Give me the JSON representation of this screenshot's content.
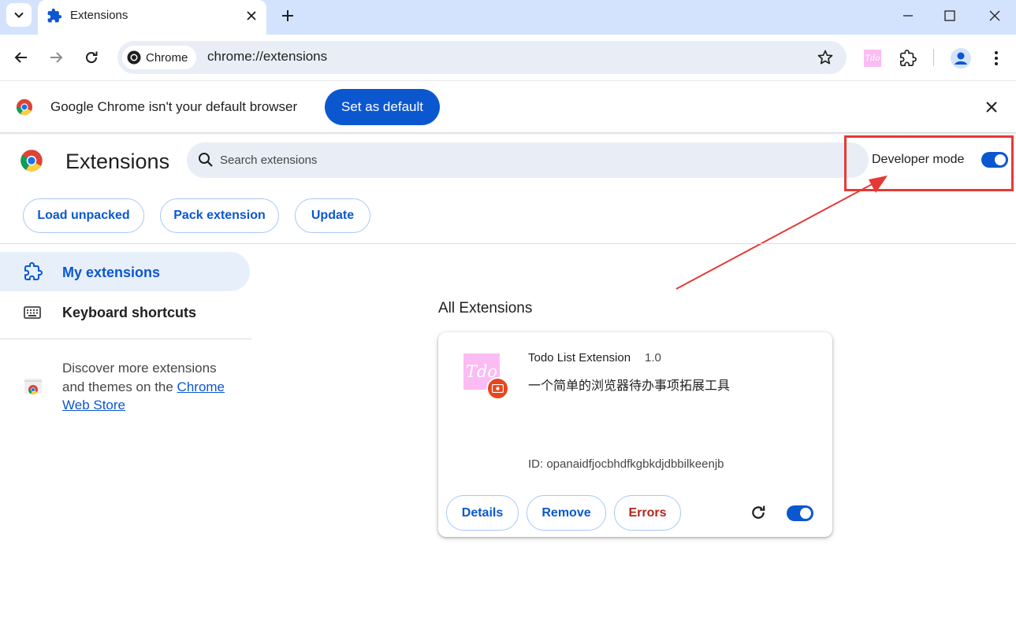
{
  "tabstrip": {
    "tab_title": "Extensions"
  },
  "toolbar": {
    "chip_label": "Chrome",
    "url": "chrome://extensions"
  },
  "infobar": {
    "message": "Google Chrome isn't your default browser",
    "button_label": "Set as default"
  },
  "header": {
    "title": "Extensions",
    "search_placeholder": "Search extensions",
    "developer_mode_label": "Developer mode",
    "developer_mode_on": true
  },
  "actions": {
    "load_unpacked": "Load unpacked",
    "pack_extension": "Pack extension",
    "update": "Update"
  },
  "sidebar": {
    "my_extensions": "My extensions",
    "keyboard_shortcuts": "Keyboard shortcuts",
    "discover_text": "Discover more extensions and themes on the ",
    "discover_link": "Chrome Web Store"
  },
  "main": {
    "section_title": "All Extensions",
    "extension": {
      "icon_text": "Tdo",
      "name": "Todo List Extension",
      "version": "1.0",
      "description": "一个简单的浏览器待办事项拓展工具",
      "id_text": "ID: opanaidfjocbhdfkgbkdjdbbilkeenjb",
      "details_label": "Details",
      "remove_label": "Remove",
      "errors_label": "Errors",
      "enabled": true
    }
  },
  "colors": {
    "accent": "#0b57d0",
    "highlight": "#e53935",
    "tabstrip_bg": "#d3e3fd"
  }
}
